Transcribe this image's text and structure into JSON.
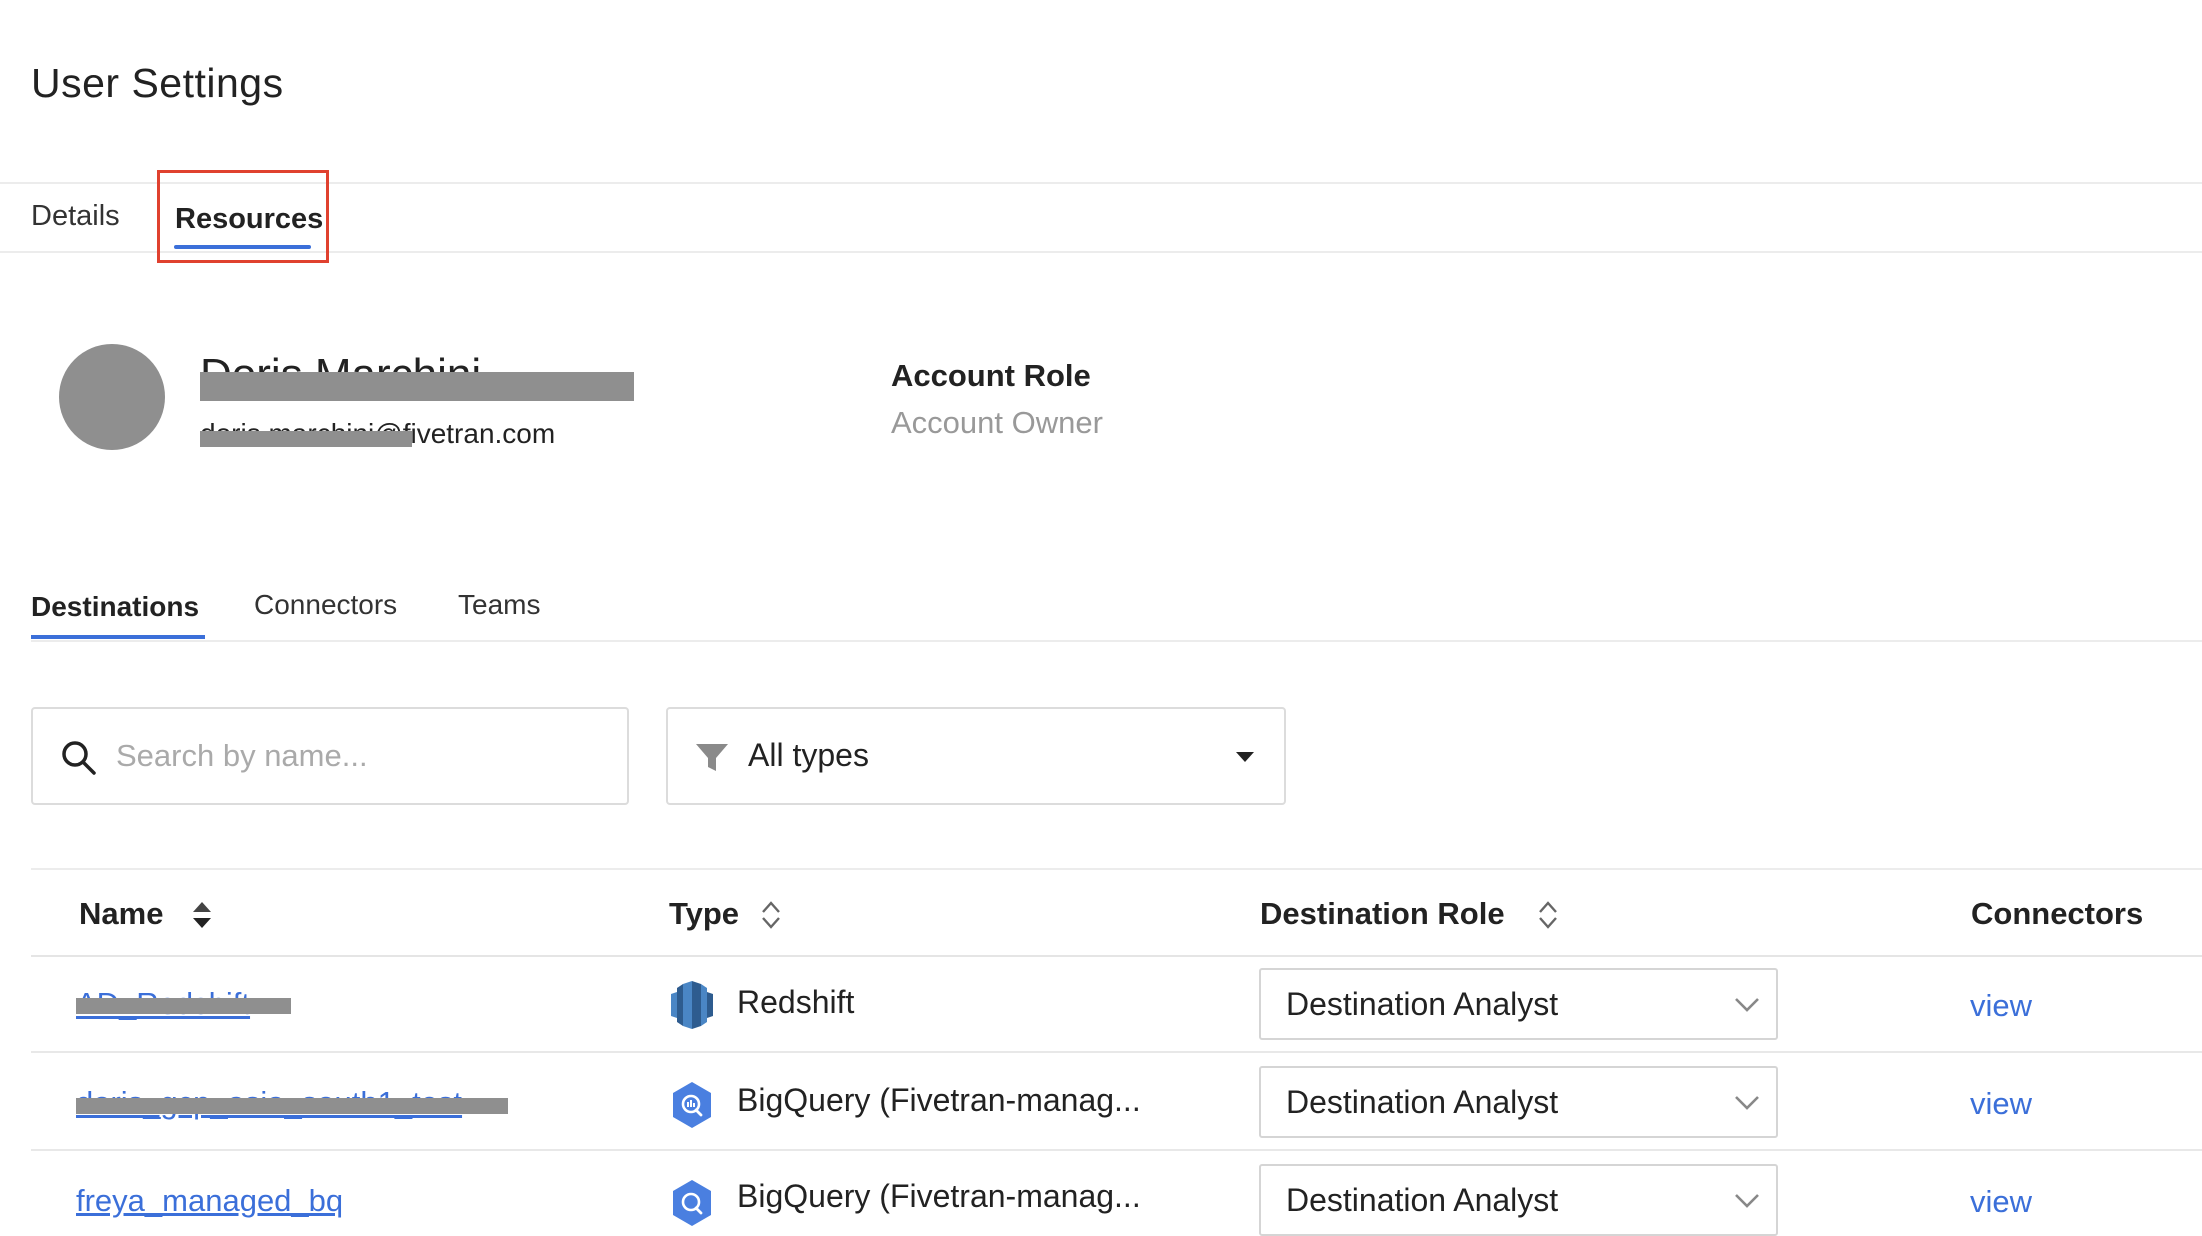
{
  "header": {
    "title": "User Settings"
  },
  "tabs": [
    {
      "label": "Details"
    },
    {
      "label": "Resources"
    }
  ],
  "user": {
    "name": "Doris Marchini",
    "email": "doris.marchini@fivetran.com",
    "account_role_label": "Account Role",
    "account_role_value": "Account Owner"
  },
  "subtabs": [
    {
      "label": "Destinations"
    },
    {
      "label": "Connectors"
    },
    {
      "label": "Teams"
    }
  ],
  "search": {
    "placeholder": "Search by name..."
  },
  "filter": {
    "value": "All types"
  },
  "table": {
    "columns": [
      "Name",
      "Type",
      "Destination Role",
      "Connectors"
    ],
    "rows": [
      {
        "name": "AD_Redshift",
        "type": "Redshift",
        "role": "Destination Analyst",
        "connectors": "view"
      },
      {
        "name": "doris_gcp_asia_south1_test",
        "type": "BigQuery (Fivetran-manag...",
        "role": "Destination Analyst",
        "connectors": "view"
      },
      {
        "name": "freya_managed_bq",
        "type": "BigQuery (Fivetran-manag...",
        "role": "Destination Analyst",
        "connectors": "view"
      }
    ]
  },
  "colors": {
    "accent": "#3b6fd9",
    "highlight": "#e0412f",
    "redaction": "#8f8f8f"
  }
}
